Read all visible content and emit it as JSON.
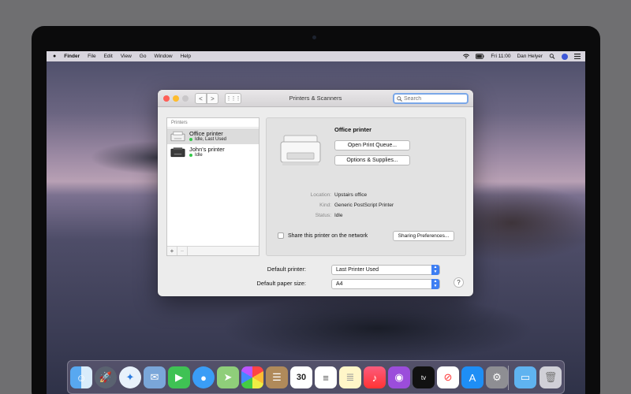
{
  "menubar": {
    "apple": "",
    "app": "Finder",
    "items": [
      "File",
      "Edit",
      "View",
      "Go",
      "Window",
      "Help"
    ],
    "clock": "Fri 11:00",
    "user": "Dan Helyer"
  },
  "window": {
    "title": "Printers & Scanners",
    "nav_back": "<",
    "nav_forward": ">",
    "grid": "⋮⋮⋮",
    "search_placeholder": "Search"
  },
  "printers": {
    "header": "Printers",
    "items": [
      {
        "name": "Office printer",
        "status": "Idle, Last Used",
        "selected": true
      },
      {
        "name": "John's printer",
        "status": "Idle",
        "selected": false
      }
    ],
    "add": "+",
    "remove": "−"
  },
  "details": {
    "name": "Office printer",
    "open_queue": "Open Print Queue...",
    "options": "Options & Supplies...",
    "location_label": "Location:",
    "location_value": "Upstairs office",
    "kind_label": "Kind:",
    "kind_value": "Generic PostScript Printer",
    "status_label": "Status:",
    "status_value": "Idle",
    "share_label": "Share this printer on the network",
    "sharing_prefs": "Sharing Preferences..."
  },
  "defaults": {
    "printer_label": "Default printer:",
    "printer_value": "Last Printer Used",
    "paper_label": "Default paper size:",
    "paper_value": "A4",
    "help": "?"
  },
  "dock": {
    "calendar_day": "30",
    "tv_label": "tv"
  },
  "colors": {
    "accent": "#3d7ef3",
    "status_green": "#34c84a",
    "close": "#fe5f57",
    "minimize": "#febc2e"
  }
}
